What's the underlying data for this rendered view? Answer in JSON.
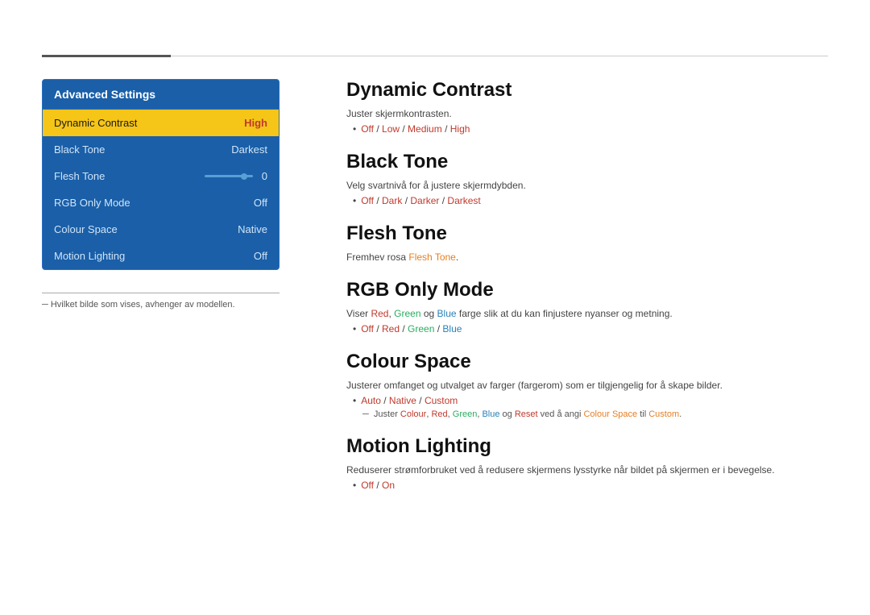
{
  "topbar": {
    "filled_label": "filled-bar",
    "empty_label": "empty-bar"
  },
  "left_panel": {
    "title": "Advanced Settings",
    "items": [
      {
        "label": "Dynamic Contrast",
        "value": "High",
        "active": true
      },
      {
        "label": "Black Tone",
        "value": "Darkest",
        "active": false
      },
      {
        "label": "RGB Only Mode",
        "value": "Off",
        "active": false
      },
      {
        "label": "Colour Space",
        "value": "Native",
        "active": false
      },
      {
        "label": "Motion Lighting",
        "value": "Off",
        "active": false
      }
    ],
    "flesh_tone": {
      "label": "Flesh Tone",
      "value": "0"
    },
    "note": "─  Hvilket bilde som vises, avhenger av modellen."
  },
  "sections": [
    {
      "id": "dynamic-contrast",
      "title": "Dynamic Contrast",
      "desc": "Juster skjermkontrasten.",
      "bullet": [
        {
          "text_parts": [
            {
              "text": "Off",
              "style": "highlight-red"
            },
            {
              "text": " / ",
              "style": "normal"
            },
            {
              "text": "Low",
              "style": "highlight-red"
            },
            {
              "text": " / ",
              "style": "normal"
            },
            {
              "text": "Medium",
              "style": "highlight-red"
            },
            {
              "text": " / ",
              "style": "normal"
            },
            {
              "text": "High",
              "style": "highlight-red"
            }
          ]
        }
      ]
    },
    {
      "id": "black-tone",
      "title": "Black Tone",
      "desc": "Velg svartnivå for å justere skjermdybden.",
      "bullet": [
        {
          "text_parts": [
            {
              "text": "Off",
              "style": "highlight-red"
            },
            {
              "text": " / ",
              "style": "normal"
            },
            {
              "text": "Dark",
              "style": "highlight-red"
            },
            {
              "text": " / ",
              "style": "normal"
            },
            {
              "text": "Darker",
              "style": "highlight-red"
            },
            {
              "text": " / ",
              "style": "normal"
            },
            {
              "text": "Darkest",
              "style": "highlight-red"
            }
          ]
        }
      ]
    },
    {
      "id": "flesh-tone",
      "title": "Flesh Tone",
      "desc": "Fremhev rosa",
      "desc_highlight": "Flesh Tone",
      "desc_highlight_style": "highlight-orange",
      "desc_end": "."
    },
    {
      "id": "rgb-only-mode",
      "title": "RGB Only Mode",
      "desc_parts": [
        {
          "text": "Viser ",
          "style": "normal"
        },
        {
          "text": "Red",
          "style": "highlight-red"
        },
        {
          "text": ", ",
          "style": "normal"
        },
        {
          "text": "Green",
          "style": "highlight-green"
        },
        {
          "text": " og ",
          "style": "normal"
        },
        {
          "text": "Blue",
          "style": "highlight-blue"
        },
        {
          "text": " farge slik at du kan finjustere nyanser og metning.",
          "style": "normal"
        }
      ],
      "bullet": [
        {
          "text_parts": [
            {
              "text": "Off",
              "style": "highlight-red"
            },
            {
              "text": " / ",
              "style": "normal"
            },
            {
              "text": "Red",
              "style": "highlight-red"
            },
            {
              "text": " / ",
              "style": "normal"
            },
            {
              "text": "Green",
              "style": "highlight-green"
            },
            {
              "text": " / ",
              "style": "normal"
            },
            {
              "text": "Blue",
              "style": "highlight-blue"
            }
          ]
        }
      ]
    },
    {
      "id": "colour-space",
      "title": "Colour Space",
      "desc": "Justerer omfanget og utvalget av farger (fargerom) som er tilgjengelig for å skape bilder.",
      "bullet": [
        {
          "text_parts": [
            {
              "text": "Auto",
              "style": "highlight-red"
            },
            {
              "text": " / ",
              "style": "normal"
            },
            {
              "text": "Native",
              "style": "highlight-red"
            },
            {
              "text": " / ",
              "style": "normal"
            },
            {
              "text": "Custom",
              "style": "highlight-red"
            }
          ]
        }
      ],
      "subnote_parts": [
        {
          "text": "─  Juster ",
          "style": "normal"
        },
        {
          "text": "Colour",
          "style": "highlight-red"
        },
        {
          "text": ", ",
          "style": "normal"
        },
        {
          "text": "Red",
          "style": "highlight-red"
        },
        {
          "text": ", ",
          "style": "normal"
        },
        {
          "text": "Green",
          "style": "highlight-green"
        },
        {
          "text": ", ",
          "style": "normal"
        },
        {
          "text": "Blue",
          "style": "highlight-blue"
        },
        {
          "text": " og ",
          "style": "normal"
        },
        {
          "text": "Reset",
          "style": "highlight-red"
        },
        {
          "text": " ved å angi ",
          "style": "normal"
        },
        {
          "text": "Colour Space",
          "style": "highlight-orange"
        },
        {
          "text": " til ",
          "style": "normal"
        },
        {
          "text": "Custom",
          "style": "highlight-orange"
        },
        {
          "text": ".",
          "style": "normal"
        }
      ]
    },
    {
      "id": "motion-lighting",
      "title": "Motion Lighting",
      "desc": "Reduserer strømforbruket ved å redusere skjermens lysstyrke når bildet på skjermen er i bevegelse.",
      "bullet": [
        {
          "text_parts": [
            {
              "text": "Off",
              "style": "highlight-red"
            },
            {
              "text": " / ",
              "style": "normal"
            },
            {
              "text": "On",
              "style": "highlight-red"
            }
          ]
        }
      ]
    }
  ]
}
